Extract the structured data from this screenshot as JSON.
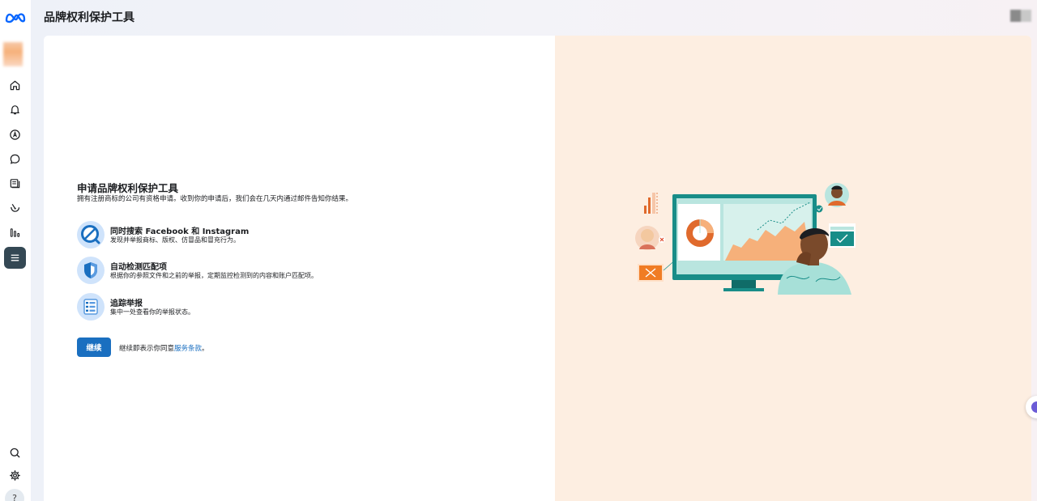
{
  "header": {
    "title": "品牌权利保护工具"
  },
  "sidebar": {
    "logo": "meta-logo-icon",
    "items": [
      {
        "icon": "home-icon"
      },
      {
        "icon": "bell-icon"
      },
      {
        "icon": "compass-icon"
      },
      {
        "icon": "chat-bubble-icon"
      },
      {
        "icon": "pages-icon"
      },
      {
        "icon": "gauge-icon"
      },
      {
        "icon": "insights-icon"
      },
      {
        "icon": "menu-icon",
        "active": true
      }
    ],
    "bottom": [
      {
        "icon": "search-icon"
      },
      {
        "icon": "gear-icon"
      },
      {
        "icon": "help-icon",
        "label": "?"
      }
    ]
  },
  "main": {
    "heading": "申请品牌权利保护工具",
    "subtext": "拥有注册商标的公司有资格申请。收到你的申请后，我们会在几天内通过邮件告知你结果。",
    "features": [
      {
        "icon": "search-no-icon",
        "title": "同时搜索 Facebook 和 Instagram",
        "desc": "发现并举报商标、版权、仿冒品和冒充行为。"
      },
      {
        "icon": "shield-icon",
        "title": "自动检测匹配项",
        "desc": "根据你的参照文件和之前的举报，定期监控检测到的内容和账户匹配项。"
      },
      {
        "icon": "list-icon",
        "title": "追踪举报",
        "desc": "集中一处查看你的举报状态。"
      }
    ],
    "continue_label": "继续",
    "terms_prefix": "继续即表示你同意",
    "terms_link": "服务条款",
    "terms_suffix": "。"
  },
  "colors": {
    "accent": "#1a6fc0",
    "right_panel": "#fdeee1",
    "active_nav": "#344854"
  }
}
